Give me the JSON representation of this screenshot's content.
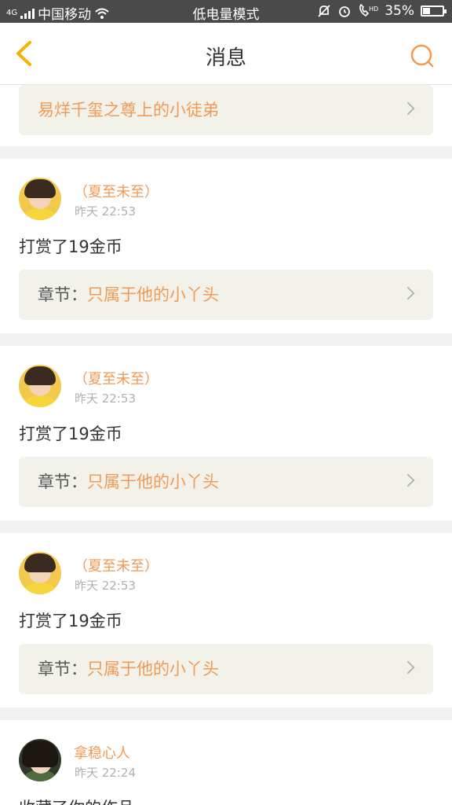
{
  "status_bar": {
    "network_badge": "4G",
    "carrier": "中国移动",
    "center_text": "低电量模式",
    "battery": "35%",
    "battery_level": 0.35,
    "icons": [
      "signal-icon",
      "wifi-icon",
      "mute-icon",
      "alarm-icon",
      "hd-call-icon",
      "battery-icon"
    ]
  },
  "nav": {
    "title": "消息",
    "back_icon": "chevron-left-icon",
    "search_icon": "search-icon",
    "accent_color": "#f5b400"
  },
  "top_card": {
    "chapter_title": "易烊千玺之尊上的小徒弟"
  },
  "messages": [
    {
      "user": "（夏至未至）",
      "time": "昨天 22:53",
      "action": "打赏了19金币",
      "chapter_label": "章节：",
      "chapter_title": "只属于他的小丫头"
    },
    {
      "user": "（夏至未至）",
      "time": "昨天 22:53",
      "action": "打赏了19金币",
      "chapter_label": "章节：",
      "chapter_title": "只属于他的小丫头"
    },
    {
      "user": "（夏至未至）",
      "time": "昨天 22:53",
      "action": "打赏了19金币",
      "chapter_label": "章节：",
      "chapter_title": "只属于他的小丫头"
    },
    {
      "user": "拿稳心人",
      "time": "昨天 22:24",
      "action": "收藏了你的作品"
    }
  ],
  "colors": {
    "accent_orange": "#f09a55",
    "chapter_bg": "#f3f2ea",
    "status_bar_bg": "#4a4a4a"
  }
}
